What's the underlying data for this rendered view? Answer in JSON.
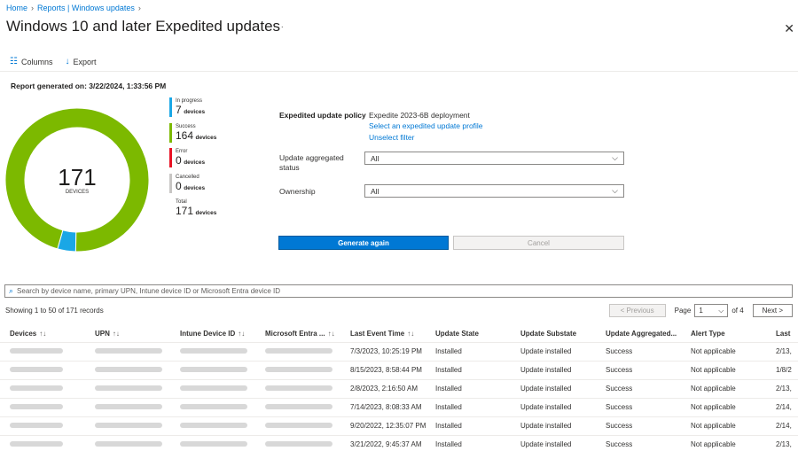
{
  "breadcrumb": {
    "home": "Home",
    "section": "Reports | Windows updates"
  },
  "page": {
    "title": "Windows 10 and later Expedited updates",
    "more": "···"
  },
  "toolbar": {
    "columns_label": "Columns",
    "export_label": "Export"
  },
  "report": {
    "generated": "Report generated on: 3/22/2024, 1:33:56 PM"
  },
  "donut": {
    "total": "171",
    "label": "DEVICES",
    "segments": [
      {
        "name": "In progress",
        "value": 7,
        "color": "#1aa7e6"
      },
      {
        "name": "Success",
        "value": 164,
        "color": "#7cb900"
      },
      {
        "name": "Error",
        "value": 0,
        "color": "#e81123"
      },
      {
        "name": "Cancelled",
        "value": 0,
        "color": "#c8c6c4"
      }
    ]
  },
  "legend": {
    "unit": "devices",
    "items": [
      {
        "name": "In progress",
        "value": "7",
        "color": "#1aa7e6"
      },
      {
        "name": "Success",
        "value": "164",
        "color": "#7cb900"
      },
      {
        "name": "Error",
        "value": "0",
        "color": "#e81123"
      },
      {
        "name": "Cancelled",
        "value": "0",
        "color": "#c8c6c4"
      }
    ],
    "total_name": "Total",
    "total_value": "171"
  },
  "filters": {
    "policy_label": "Expedited update policy",
    "policy_value": "Expedite 2023-6B deployment",
    "select_link": "Select an expedited update profile",
    "unselect_link": "Unselect filter",
    "status_label_1": "Update aggregated",
    "status_label_2": "status",
    "status_value": "All",
    "ownership_label": "Ownership",
    "ownership_value": "All"
  },
  "actions": {
    "generate": "Generate again",
    "cancel": "Cancel"
  },
  "search": {
    "placeholder": "Search by device name, primary UPN, Intune device ID or Microsoft Entra device ID"
  },
  "pagination": {
    "showing": "Showing 1 to 50 of 171 records",
    "previous": "< Previous",
    "page_label": "Page",
    "page_value": "1",
    "of": "of 4",
    "next": "Next >"
  },
  "table": {
    "headers": [
      "Devices",
      "UPN",
      "Intune Device ID",
      "Microsoft Entra ...",
      "Last Event Time",
      "Update State",
      "Update Substate",
      "Update Aggregated...",
      "Alert Type",
      "Last"
    ],
    "rows": [
      {
        "time": "7/3/2023, 10:25:19 PM",
        "state": "Installed",
        "substate": "Update installed",
        "aggregated": "Success",
        "alert": "Not applicable",
        "last": "2/13,"
      },
      {
        "time": "8/15/2023, 8:58:44 PM",
        "state": "Installed",
        "substate": "Update installed",
        "aggregated": "Success",
        "alert": "Not applicable",
        "last": "1/8/2"
      },
      {
        "time": "2/8/2023, 2:16:50 AM",
        "state": "Installed",
        "substate": "Update installed",
        "aggregated": "Success",
        "alert": "Not applicable",
        "last": "2/13,"
      },
      {
        "time": "7/14/2023, 8:08:33 AM",
        "state": "Installed",
        "substate": "Update installed",
        "aggregated": "Success",
        "alert": "Not applicable",
        "last": "2/14,"
      },
      {
        "time": "9/20/2022, 12:35:07 PM",
        "state": "Installed",
        "substate": "Update installed",
        "aggregated": "Success",
        "alert": "Not applicable",
        "last": "2/14,"
      },
      {
        "time": "3/21/2022, 9:45:37 AM",
        "state": "Installed",
        "substate": "Update installed",
        "aggregated": "Success",
        "alert": "Not applicable",
        "last": "2/13,"
      }
    ]
  }
}
